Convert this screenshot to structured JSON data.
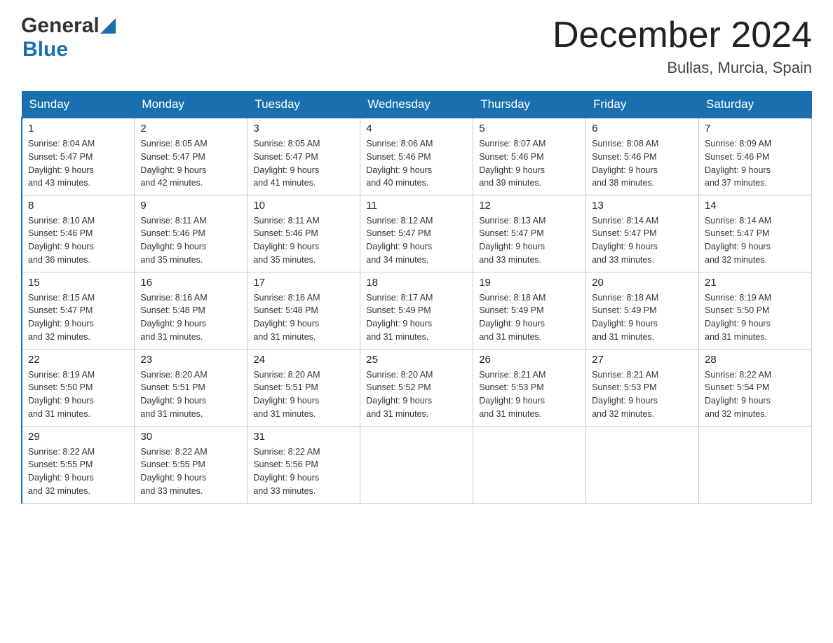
{
  "header": {
    "month_title": "December 2024",
    "location": "Bullas, Murcia, Spain",
    "logo_general": "General",
    "logo_blue": "Blue"
  },
  "days_of_week": [
    "Sunday",
    "Monday",
    "Tuesday",
    "Wednesday",
    "Thursday",
    "Friday",
    "Saturday"
  ],
  "weeks": [
    [
      {
        "day": "1",
        "sunrise": "Sunrise: 8:04 AM",
        "sunset": "Sunset: 5:47 PM",
        "daylight": "Daylight: 9 hours",
        "minutes": "and 43 minutes."
      },
      {
        "day": "2",
        "sunrise": "Sunrise: 8:05 AM",
        "sunset": "Sunset: 5:47 PM",
        "daylight": "Daylight: 9 hours",
        "minutes": "and 42 minutes."
      },
      {
        "day": "3",
        "sunrise": "Sunrise: 8:05 AM",
        "sunset": "Sunset: 5:47 PM",
        "daylight": "Daylight: 9 hours",
        "minutes": "and 41 minutes."
      },
      {
        "day": "4",
        "sunrise": "Sunrise: 8:06 AM",
        "sunset": "Sunset: 5:46 PM",
        "daylight": "Daylight: 9 hours",
        "minutes": "and 40 minutes."
      },
      {
        "day": "5",
        "sunrise": "Sunrise: 8:07 AM",
        "sunset": "Sunset: 5:46 PM",
        "daylight": "Daylight: 9 hours",
        "minutes": "and 39 minutes."
      },
      {
        "day": "6",
        "sunrise": "Sunrise: 8:08 AM",
        "sunset": "Sunset: 5:46 PM",
        "daylight": "Daylight: 9 hours",
        "minutes": "and 38 minutes."
      },
      {
        "day": "7",
        "sunrise": "Sunrise: 8:09 AM",
        "sunset": "Sunset: 5:46 PM",
        "daylight": "Daylight: 9 hours",
        "minutes": "and 37 minutes."
      }
    ],
    [
      {
        "day": "8",
        "sunrise": "Sunrise: 8:10 AM",
        "sunset": "Sunset: 5:46 PM",
        "daylight": "Daylight: 9 hours",
        "minutes": "and 36 minutes."
      },
      {
        "day": "9",
        "sunrise": "Sunrise: 8:11 AM",
        "sunset": "Sunset: 5:46 PM",
        "daylight": "Daylight: 9 hours",
        "minutes": "and 35 minutes."
      },
      {
        "day": "10",
        "sunrise": "Sunrise: 8:11 AM",
        "sunset": "Sunset: 5:46 PM",
        "daylight": "Daylight: 9 hours",
        "minutes": "and 35 minutes."
      },
      {
        "day": "11",
        "sunrise": "Sunrise: 8:12 AM",
        "sunset": "Sunset: 5:47 PM",
        "daylight": "Daylight: 9 hours",
        "minutes": "and 34 minutes."
      },
      {
        "day": "12",
        "sunrise": "Sunrise: 8:13 AM",
        "sunset": "Sunset: 5:47 PM",
        "daylight": "Daylight: 9 hours",
        "minutes": "and 33 minutes."
      },
      {
        "day": "13",
        "sunrise": "Sunrise: 8:14 AM",
        "sunset": "Sunset: 5:47 PM",
        "daylight": "Daylight: 9 hours",
        "minutes": "and 33 minutes."
      },
      {
        "day": "14",
        "sunrise": "Sunrise: 8:14 AM",
        "sunset": "Sunset: 5:47 PM",
        "daylight": "Daylight: 9 hours",
        "minutes": "and 32 minutes."
      }
    ],
    [
      {
        "day": "15",
        "sunrise": "Sunrise: 8:15 AM",
        "sunset": "Sunset: 5:47 PM",
        "daylight": "Daylight: 9 hours",
        "minutes": "and 32 minutes."
      },
      {
        "day": "16",
        "sunrise": "Sunrise: 8:16 AM",
        "sunset": "Sunset: 5:48 PM",
        "daylight": "Daylight: 9 hours",
        "minutes": "and 31 minutes."
      },
      {
        "day": "17",
        "sunrise": "Sunrise: 8:16 AM",
        "sunset": "Sunset: 5:48 PM",
        "daylight": "Daylight: 9 hours",
        "minutes": "and 31 minutes."
      },
      {
        "day": "18",
        "sunrise": "Sunrise: 8:17 AM",
        "sunset": "Sunset: 5:49 PM",
        "daylight": "Daylight: 9 hours",
        "minutes": "and 31 minutes."
      },
      {
        "day": "19",
        "sunrise": "Sunrise: 8:18 AM",
        "sunset": "Sunset: 5:49 PM",
        "daylight": "Daylight: 9 hours",
        "minutes": "and 31 minutes."
      },
      {
        "day": "20",
        "sunrise": "Sunrise: 8:18 AM",
        "sunset": "Sunset: 5:49 PM",
        "daylight": "Daylight: 9 hours",
        "minutes": "and 31 minutes."
      },
      {
        "day": "21",
        "sunrise": "Sunrise: 8:19 AM",
        "sunset": "Sunset: 5:50 PM",
        "daylight": "Daylight: 9 hours",
        "minutes": "and 31 minutes."
      }
    ],
    [
      {
        "day": "22",
        "sunrise": "Sunrise: 8:19 AM",
        "sunset": "Sunset: 5:50 PM",
        "daylight": "Daylight: 9 hours",
        "minutes": "and 31 minutes."
      },
      {
        "day": "23",
        "sunrise": "Sunrise: 8:20 AM",
        "sunset": "Sunset: 5:51 PM",
        "daylight": "Daylight: 9 hours",
        "minutes": "and 31 minutes."
      },
      {
        "day": "24",
        "sunrise": "Sunrise: 8:20 AM",
        "sunset": "Sunset: 5:51 PM",
        "daylight": "Daylight: 9 hours",
        "minutes": "and 31 minutes."
      },
      {
        "day": "25",
        "sunrise": "Sunrise: 8:20 AM",
        "sunset": "Sunset: 5:52 PM",
        "daylight": "Daylight: 9 hours",
        "minutes": "and 31 minutes."
      },
      {
        "day": "26",
        "sunrise": "Sunrise: 8:21 AM",
        "sunset": "Sunset: 5:53 PM",
        "daylight": "Daylight: 9 hours",
        "minutes": "and 31 minutes."
      },
      {
        "day": "27",
        "sunrise": "Sunrise: 8:21 AM",
        "sunset": "Sunset: 5:53 PM",
        "daylight": "Daylight: 9 hours",
        "minutes": "and 32 minutes."
      },
      {
        "day": "28",
        "sunrise": "Sunrise: 8:22 AM",
        "sunset": "Sunset: 5:54 PM",
        "daylight": "Daylight: 9 hours",
        "minutes": "and 32 minutes."
      }
    ],
    [
      {
        "day": "29",
        "sunrise": "Sunrise: 8:22 AM",
        "sunset": "Sunset: 5:55 PM",
        "daylight": "Daylight: 9 hours",
        "minutes": "and 32 minutes."
      },
      {
        "day": "30",
        "sunrise": "Sunrise: 8:22 AM",
        "sunset": "Sunset: 5:55 PM",
        "daylight": "Daylight: 9 hours",
        "minutes": "and 33 minutes."
      },
      {
        "day": "31",
        "sunrise": "Sunrise: 8:22 AM",
        "sunset": "Sunset: 5:56 PM",
        "daylight": "Daylight: 9 hours",
        "minutes": "and 33 minutes."
      },
      null,
      null,
      null,
      null
    ]
  ]
}
